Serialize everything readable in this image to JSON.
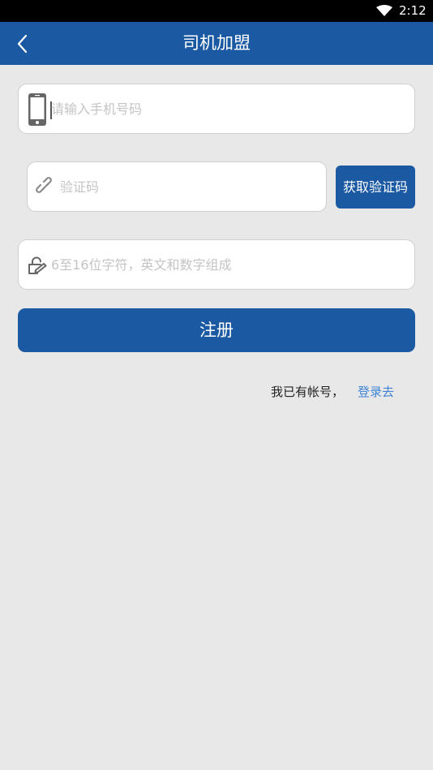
{
  "status_bar": {
    "time": "2:12",
    "icons": [
      "wifi-icon"
    ]
  },
  "app_bar": {
    "title": "司机加盟",
    "back_icon": "chevron-left-icon"
  },
  "form": {
    "phone": {
      "placeholder": "请输入手机号码",
      "value": "",
      "icon": "phone-icon"
    },
    "code": {
      "placeholder": "验证码",
      "value": "",
      "icon": "link-icon"
    },
    "get_code_label": "获取验证码",
    "password": {
      "placeholder": "6至16位字符，英文和数字组成",
      "value": "",
      "icon": "edit-lock-icon"
    },
    "register_label": "注册"
  },
  "login": {
    "prompt": "我已有帐号，",
    "link": "登录去"
  },
  "colors": {
    "primary": "#1b5aa3",
    "background": "#e8e8e8",
    "link": "#3f85d4",
    "placeholder": "#c4c4c4"
  }
}
